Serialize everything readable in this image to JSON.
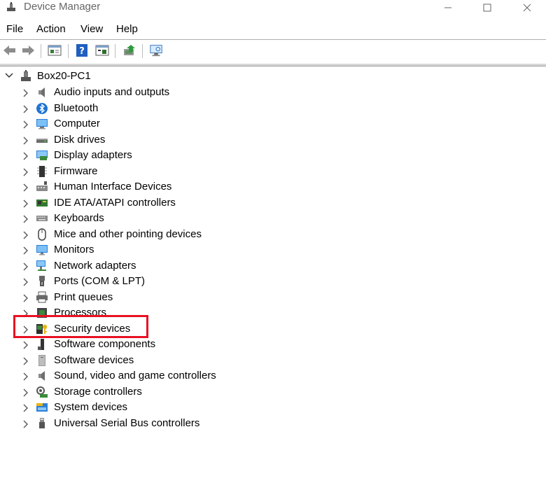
{
  "window": {
    "title": "Device Manager",
    "buttons": {
      "minimize": "—",
      "maximize": "☐",
      "close": "✕"
    }
  },
  "menu": [
    "File",
    "Action",
    "View",
    "Help"
  ],
  "toolbar": {
    "buttons": [
      "back-icon",
      "forward-icon",
      "properties-icon",
      "help-icon",
      "device-list-icon",
      "update-driver-icon",
      "scan-hardware-icon"
    ]
  },
  "tree": {
    "root": "Box20-PC1",
    "nodes": [
      {
        "label": "Audio inputs and outputs",
        "icon": "speaker-icon"
      },
      {
        "label": "Bluetooth",
        "icon": "bluetooth-icon"
      },
      {
        "label": "Computer",
        "icon": "computer-icon"
      },
      {
        "label": "Disk drives",
        "icon": "disk-drive-icon"
      },
      {
        "label": "Display adapters",
        "icon": "display-adapter-icon"
      },
      {
        "label": "Firmware",
        "icon": "firmware-icon"
      },
      {
        "label": "Human Interface Devices",
        "icon": "hid-icon"
      },
      {
        "label": "IDE ATA/ATAPI controllers",
        "icon": "ide-controller-icon"
      },
      {
        "label": "Keyboards",
        "icon": "keyboard-icon"
      },
      {
        "label": "Mice and other pointing devices",
        "icon": "mouse-icon"
      },
      {
        "label": "Monitors",
        "icon": "monitor-icon"
      },
      {
        "label": "Network adapters",
        "icon": "network-adapter-icon"
      },
      {
        "label": "Ports (COM & LPT)",
        "icon": "port-icon"
      },
      {
        "label": "Print queues",
        "icon": "printer-icon"
      },
      {
        "label": "Processors",
        "icon": "processor-icon"
      },
      {
        "label": "Security devices",
        "icon": "security-device-icon"
      },
      {
        "label": "Software components",
        "icon": "software-component-icon"
      },
      {
        "label": "Software devices",
        "icon": "software-device-icon"
      },
      {
        "label": "Sound, video and game controllers",
        "icon": "sound-controller-icon"
      },
      {
        "label": "Storage controllers",
        "icon": "storage-controller-icon"
      },
      {
        "label": "System devices",
        "icon": "system-device-icon"
      },
      {
        "label": "Universal Serial Bus controllers",
        "icon": "usb-icon"
      }
    ]
  },
  "colors": {
    "highlight": "#e81123",
    "accent": "#0078d7"
  }
}
